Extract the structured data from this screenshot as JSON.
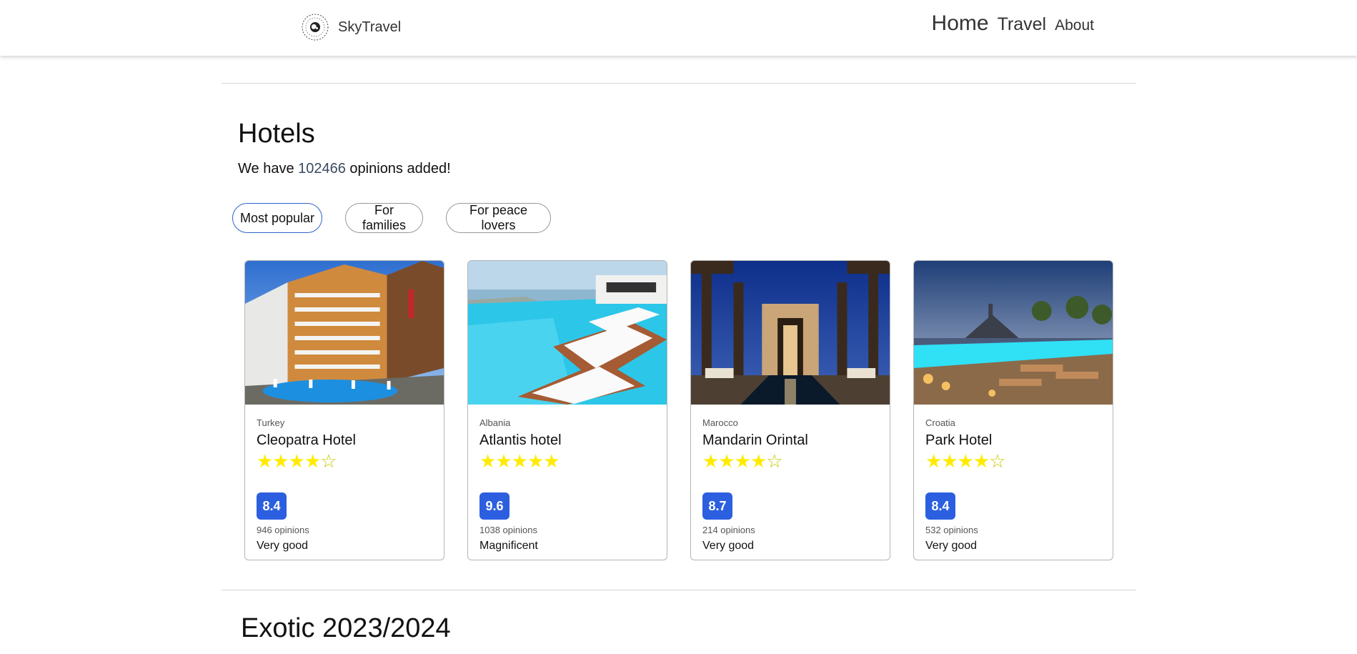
{
  "navbar": {
    "brand": "SkyTravel",
    "logo_icon": "globe-stamp-logo",
    "links": [
      {
        "label": "Home"
      },
      {
        "label": "Travel"
      },
      {
        "label": "About"
      }
    ]
  },
  "hotels_section": {
    "title": "Hotels",
    "subtitle_prefix": "We have ",
    "opinions_count": "102466",
    "subtitle_suffix": " opinions added!",
    "filters": [
      {
        "label": "Most popular",
        "active": true
      },
      {
        "label": "For families",
        "active": false
      },
      {
        "label": "For peace lovers",
        "active": false
      }
    ],
    "cards": [
      {
        "country": "Turkey",
        "name": "Cleopatra Hotel",
        "stars": 4,
        "score": "8.4",
        "opinions": "946 opinions",
        "rating": "Very good",
        "image": "hotel-building-pool-photo"
      },
      {
        "country": "Albania",
        "name": "Atlantis hotel",
        "stars": 5,
        "score": "9.6",
        "opinions": "1038 opinions",
        "rating": "Magnificent",
        "image": "infinity-pool-loungers-photo"
      },
      {
        "country": "Marocco",
        "name": "Mandarin Orintal",
        "stars": 4,
        "score": "8.7",
        "opinions": "214 opinions",
        "rating": "Very good",
        "image": "night-courtyard-pool-photo"
      },
      {
        "country": "Croatia",
        "name": "Park Hotel",
        "stars": 4,
        "score": "8.4",
        "opinions": "532 opinions",
        "rating": "Very good",
        "image": "sunset-pool-town-photo"
      }
    ]
  },
  "exotic_section": {
    "title": "Exotic 2023/2024"
  },
  "colors": {
    "score_badge": "#2c5fe0",
    "star": "#ffeb00",
    "active_pill_border": "#2f62c8"
  }
}
